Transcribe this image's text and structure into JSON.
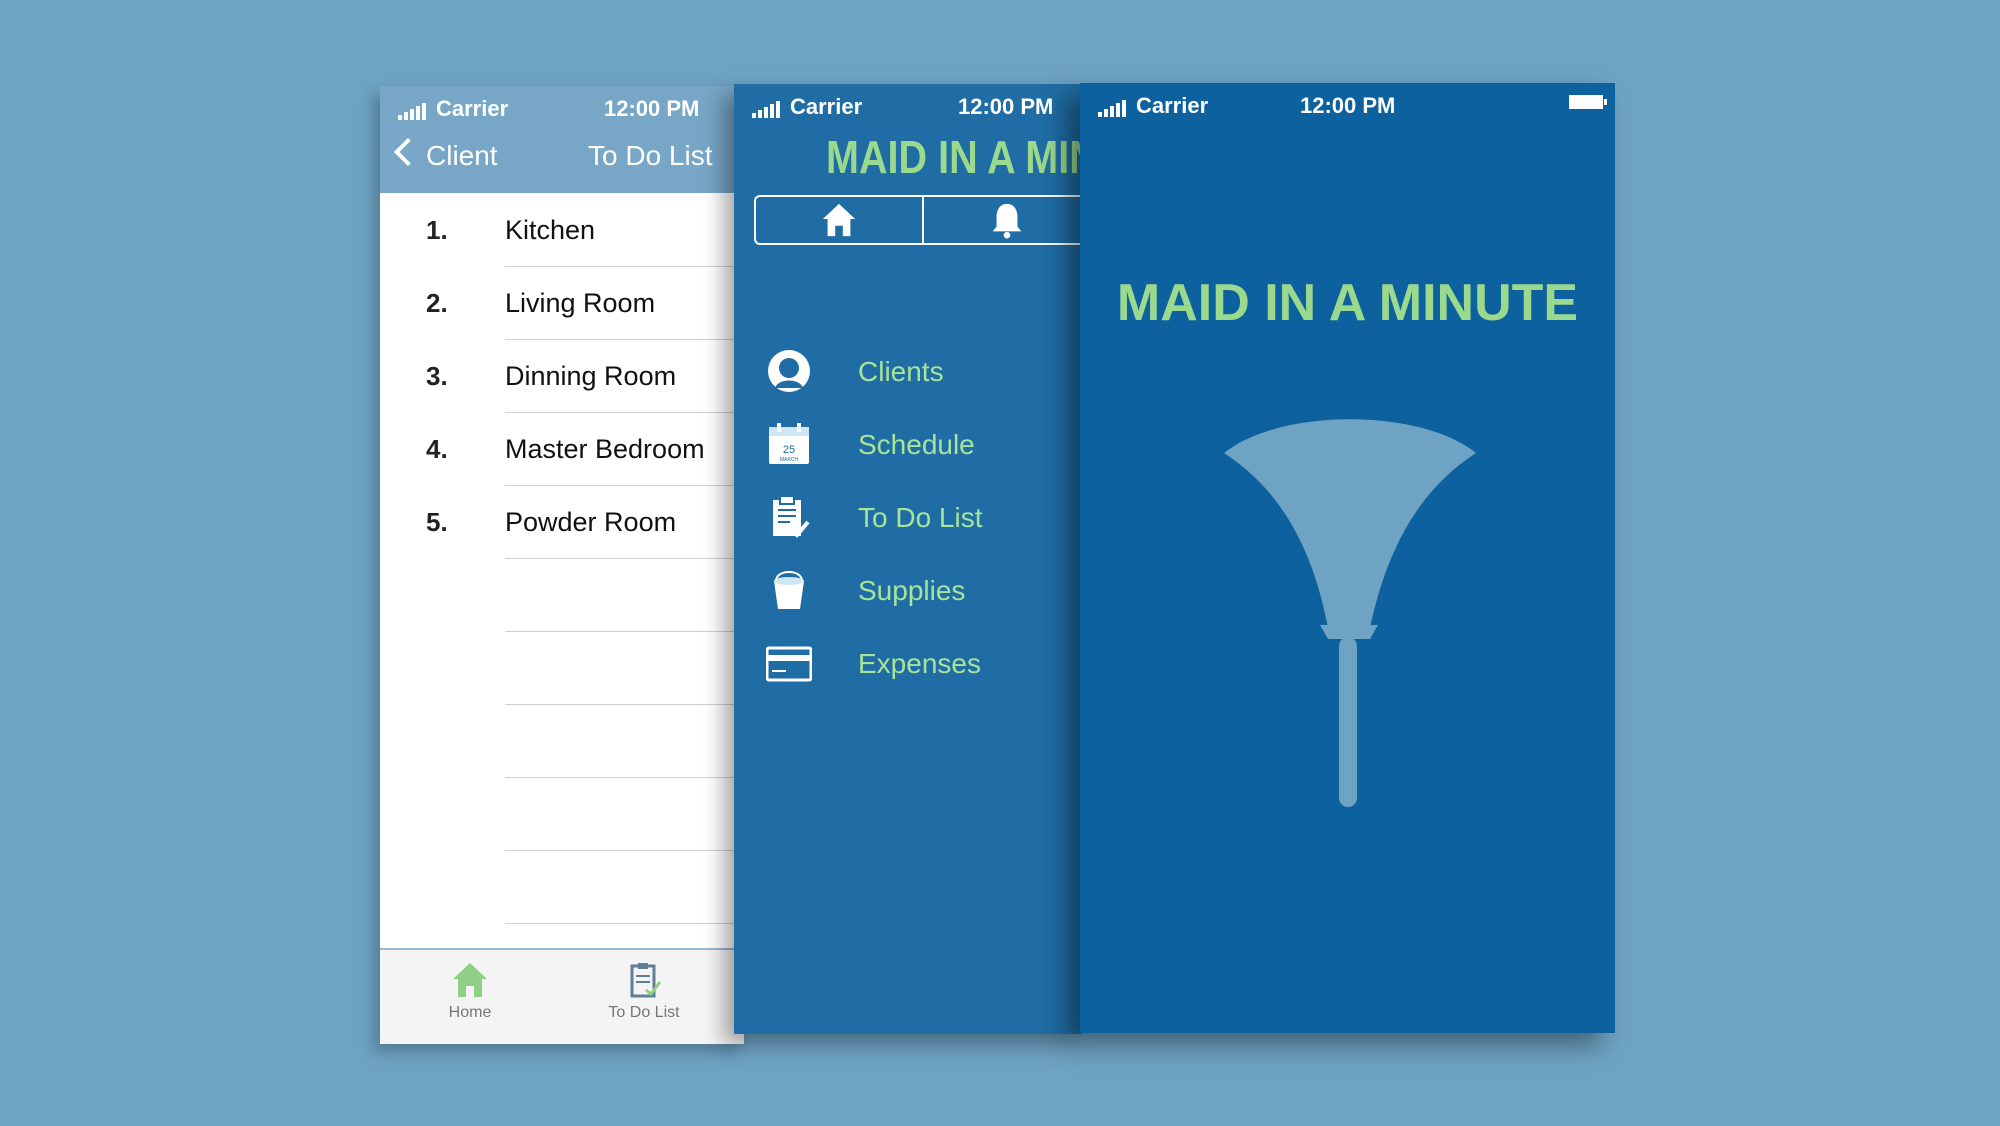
{
  "colors": {
    "background": "#6ea3c3",
    "menu_bg": "#1f6da4",
    "splash_bg": "#0c619e",
    "accent_green": "#9bd98f",
    "navbar": "#77a6c6"
  },
  "status_bar": {
    "carrier": "Carrier",
    "time": "12:00 PM"
  },
  "todo_screen": {
    "back_label": "Client",
    "title": "To Do List",
    "items": [
      {
        "num": "1.",
        "label": "Kitchen"
      },
      {
        "num": "2.",
        "label": "Living Room"
      },
      {
        "num": "3.",
        "label": "Dinning Room"
      },
      {
        "num": "4.",
        "label": "Master Bedroom"
      },
      {
        "num": "5.",
        "label": "Powder Room"
      }
    ],
    "tabs": [
      {
        "label": "Home",
        "icon": "home-icon"
      },
      {
        "label": "To Do List",
        "icon": "clipboard-icon"
      }
    ]
  },
  "menu_screen": {
    "title": "MAID IN A MINUTE",
    "segments": [
      {
        "icon": "home-icon"
      },
      {
        "icon": "bell-icon"
      }
    ],
    "items": [
      {
        "label": "Clients",
        "icon": "person-icon"
      },
      {
        "label": "Schedule",
        "icon": "calendar-icon"
      },
      {
        "label": "To Do List",
        "icon": "clipboard-check-icon"
      },
      {
        "label": "Supplies",
        "icon": "bucket-icon"
      },
      {
        "label": "Expenses",
        "icon": "credit-card-icon"
      }
    ],
    "calendar_day": "25",
    "calendar_month": "MARCH"
  },
  "splash_screen": {
    "title": "MAID IN A MINUTE",
    "icon": "feather-duster-icon"
  }
}
